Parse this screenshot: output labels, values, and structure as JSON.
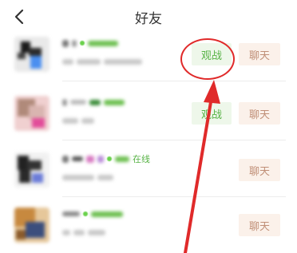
{
  "header": {
    "title": "好友",
    "back_icon": "chevron-left-icon"
  },
  "friends": [
    {
      "status": "",
      "watch_label": "观战",
      "chat_label": "聊天",
      "avatar_colors": [
        "#1b1b1b",
        "#4a8ff0",
        "#e9e9e9"
      ]
    },
    {
      "status": "",
      "watch_label": "观战",
      "chat_label": "聊天",
      "avatar_colors": [
        "#b08a7a",
        "#e24d9a",
        "#f0d0d0"
      ]
    },
    {
      "status": "在线",
      "watch_label": "",
      "chat_label": "聊天",
      "avatar_colors": [
        "#222222",
        "#6c7dd8",
        "#f1f1f1"
      ]
    },
    {
      "status": "",
      "watch_label": "",
      "chat_label": "聊天",
      "avatar_colors": [
        "#c7893f",
        "#3b4e7d",
        "#e6c79a"
      ]
    }
  ],
  "colors": {
    "accent_green": "#58b346",
    "watch_bg": "#eef7ea",
    "chat_bg": "#fbf1ea",
    "chat_text": "#c08f77",
    "annotation_red": "#e02a2a"
  }
}
